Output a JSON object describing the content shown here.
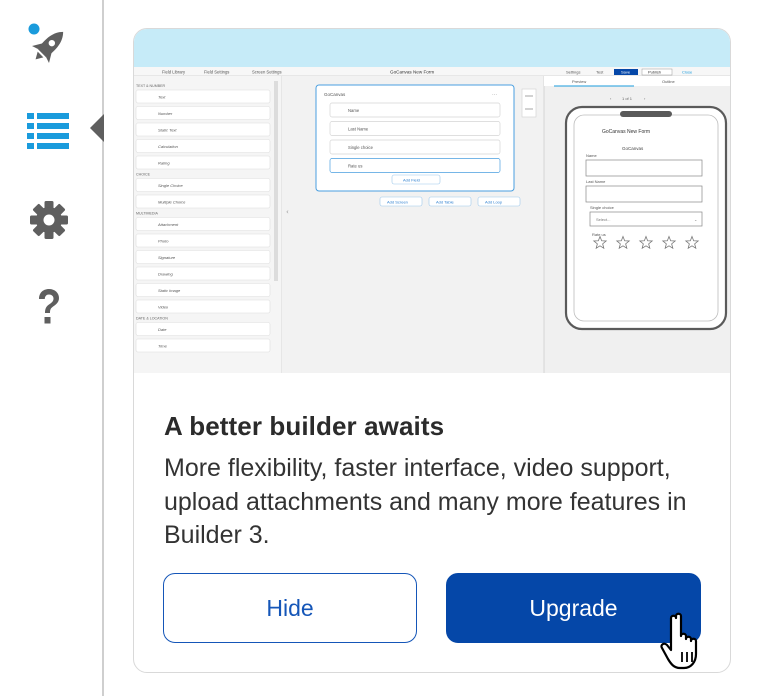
{
  "sidebar": {
    "items": [
      {
        "name": "getting-started",
        "icon": "rocket-icon",
        "active": false,
        "has_notification_dot": true
      },
      {
        "name": "form-builder",
        "icon": "list-icon",
        "active": true
      },
      {
        "name": "settings",
        "icon": "gear-icon",
        "active": false
      },
      {
        "name": "help",
        "icon": "question-mark-icon",
        "active": false
      }
    ]
  },
  "card": {
    "title": "A better builder awaits",
    "description": "More flexibility, faster interface, video support, upload attachments and many more features in Builder 3.",
    "hide_label": "Hide",
    "upgrade_label": "Upgrade",
    "preview": {
      "form_title": "GoCanvas New Form",
      "panels": [
        "Field Library",
        "Field Settings",
        "Screen Settings"
      ],
      "tabs": [
        "Preview",
        "Outline"
      ],
      "header_buttons": [
        "Settings",
        "Test",
        "Save",
        "Publish",
        "Close"
      ],
      "library_sections": [
        {
          "heading": "TEXT & NUMBER",
          "items": [
            "Text",
            "Number",
            "Static Text",
            "Calculation",
            "Rating"
          ]
        },
        {
          "heading": "CHOICE",
          "items": [
            "Single Choice",
            "Multiple Choice"
          ]
        },
        {
          "heading": "MULTIMEDIA",
          "items": [
            "Attachment",
            "Photo",
            "Signature",
            "Drawing",
            "Static Image",
            "Video"
          ]
        },
        {
          "heading": "DATE & LOCATION",
          "items": [
            "Date",
            "Time"
          ]
        }
      ],
      "screen_title": "GoCanvas",
      "screen_fields": [
        "Name",
        "Last Name",
        "Single choice",
        "Rate us"
      ],
      "add_field": "Add Field",
      "screen_actions": [
        "Add Screen",
        "Add Table",
        "Add Loop"
      ],
      "pager": "1 of 1",
      "phone": {
        "title": "GoCanvas New Form",
        "subtitle": "GoCanvas",
        "fields": [
          "Name",
          "Last Name",
          "Single choice",
          "Rate us"
        ],
        "select_placeholder": "Select..."
      }
    }
  },
  "colors": {
    "accent_blue": "#1a9bdc",
    "primary_button": "#0547a8",
    "preview_bg": "#c6ebf8",
    "icon_gray": "#5f5f5f"
  }
}
